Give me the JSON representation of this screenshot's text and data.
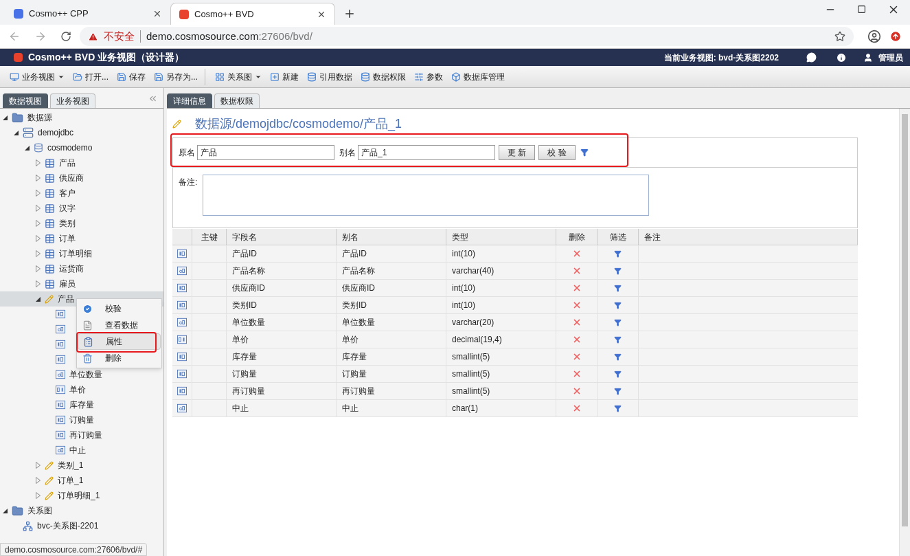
{
  "browser": {
    "tabs": [
      {
        "title": "Cosmo++ CPP",
        "selected": false
      },
      {
        "title": "Cosmo++ BVD",
        "selected": true
      }
    ],
    "security": "不安全",
    "url_host": "demo.cosmosource.com",
    "url_path": ":27606/bvd/"
  },
  "app_bar": {
    "title": "Cosmo++ BVD 业务视图（设计器）",
    "current_view": "当前业务视图: bvd-关系图2202",
    "user": "管理员"
  },
  "toolbar": {
    "groups": [
      {
        "items": [
          {
            "label": "业务视图",
            "dropdown": true
          },
          {
            "label": "打开...",
            "dropdown": false
          },
          {
            "label": "保存",
            "dropdown": false
          },
          {
            "label": "另存为...",
            "dropdown": false
          }
        ]
      },
      {
        "items": [
          {
            "label": "关系图",
            "dropdown": true
          },
          {
            "label": "新建",
            "dropdown": false
          },
          {
            "label": "引用数据",
            "dropdown": false
          },
          {
            "label": "数据权限",
            "dropdown": false
          },
          {
            "label": "参数",
            "dropdown": false
          },
          {
            "label": "数据库管理",
            "dropdown": false
          }
        ]
      }
    ]
  },
  "sidebar": {
    "tabs": [
      {
        "label": "数据视图",
        "selected": true
      },
      {
        "label": "业务视图",
        "selected": false
      }
    ],
    "tree": [
      {
        "label": "数据源",
        "kind": "folder",
        "expanded": true,
        "selected": false,
        "children": [
          {
            "label": "demojdbc",
            "kind": "server",
            "expanded": true,
            "selected": false,
            "children": [
              {
                "label": "cosmodemo",
                "kind": "database",
                "expanded": true,
                "selected": false,
                "children": [
                  {
                    "label": "产品",
                    "kind": "table",
                    "expanded": false,
                    "selected": false
                  },
                  {
                    "label": "供应商",
                    "kind": "table",
                    "expanded": false,
                    "selected": false
                  },
                  {
                    "label": "客户",
                    "kind": "table",
                    "expanded": false,
                    "selected": false
                  },
                  {
                    "label": "汉字",
                    "kind": "table",
                    "expanded": false,
                    "selected": false
                  },
                  {
                    "label": "类别",
                    "kind": "table",
                    "expanded": false,
                    "selected": false
                  },
                  {
                    "label": "订单",
                    "kind": "table",
                    "expanded": false,
                    "selected": false
                  },
                  {
                    "label": "订单明细",
                    "kind": "table",
                    "expanded": false,
                    "selected": false
                  },
                  {
                    "label": "运货商",
                    "kind": "table",
                    "expanded": false,
                    "selected": false
                  },
                  {
                    "label": "雇员",
                    "kind": "table",
                    "expanded": false,
                    "selected": false
                  },
                  {
                    "label": "产品",
                    "kind": "view",
                    "expanded": true,
                    "selected": true,
                    "children": [
                      {
                        "kind": "int",
                        "selected": false
                      },
                      {
                        "kind": "text",
                        "selected": false
                      },
                      {
                        "kind": "int",
                        "selected": false
                      },
                      {
                        "kind": "int",
                        "selected": false
                      },
                      {
                        "label": "单位数量",
                        "kind": "text",
                        "selected": false
                      },
                      {
                        "label": "单价",
                        "kind": "decimal",
                        "selected": false
                      },
                      {
                        "label": "库存量",
                        "kind": "int",
                        "selected": false
                      },
                      {
                        "label": "订购量",
                        "kind": "int",
                        "selected": false
                      },
                      {
                        "label": "再订购量",
                        "kind": "int",
                        "selected": false
                      },
                      {
                        "label": "中止",
                        "kind": "text",
                        "selected": false
                      }
                    ]
                  },
                  {
                    "label": "类别_1",
                    "kind": "view",
                    "expanded": false,
                    "selected": false
                  },
                  {
                    "label": "订单_1",
                    "kind": "view",
                    "expanded": false,
                    "selected": false
                  },
                  {
                    "label": "订单明细_1",
                    "kind": "view",
                    "expanded": false,
                    "selected": false
                  }
                ]
              }
            ]
          }
        ]
      },
      {
        "label": "关系图",
        "kind": "folder",
        "expanded": true,
        "selected": false,
        "children": [
          {
            "label": "bvc-关系图-2201",
            "kind": "diagram",
            "selected": false
          }
        ]
      }
    ]
  },
  "context_menu": {
    "items": [
      {
        "label": "校验",
        "kind": "check",
        "selected": false
      },
      {
        "label": "查看数据",
        "kind": "document",
        "selected": false
      },
      {
        "label": "属性",
        "kind": "properties",
        "selected": true
      },
      {
        "label": "删除",
        "kind": "trash",
        "selected": false
      }
    ]
  },
  "main": {
    "tabs": [
      {
        "label": "详细信息",
        "selected": true
      },
      {
        "label": "数据权限",
        "selected": false
      }
    ],
    "title": "数据源/demojdbc/cosmodemo/产品_1",
    "form": {
      "original_label": "原名",
      "original_value": "产品",
      "alias_label": "别名",
      "alias_value": "产品_1",
      "buttons": [
        "更 新",
        "校 验"
      ]
    },
    "remark_label": "备注:",
    "table": {
      "columns": [
        "主键",
        "字段名",
        "别名",
        "类型",
        "删除",
        "筛选",
        "备注"
      ],
      "rows": [
        {
          "kind": "int",
          "field": "产品ID",
          "alias": "产品ID",
          "type": "int(10)"
        },
        {
          "kind": "text",
          "field": "产品名称",
          "alias": "产品名称",
          "type": "varchar(40)"
        },
        {
          "kind": "int",
          "field": "供应商ID",
          "alias": "供应商ID",
          "type": "int(10)"
        },
        {
          "kind": "int",
          "field": "类别ID",
          "alias": "类别ID",
          "type": "int(10)"
        },
        {
          "kind": "text",
          "field": "单位数量",
          "alias": "单位数量",
          "type": "varchar(20)"
        },
        {
          "kind": "decimal",
          "field": "单价",
          "alias": "单价",
          "type": "decimal(19,4)"
        },
        {
          "kind": "int",
          "field": "库存量",
          "alias": "库存量",
          "type": "smallint(5)"
        },
        {
          "kind": "int",
          "field": "订购量",
          "alias": "订购量",
          "type": "smallint(5)"
        },
        {
          "kind": "int",
          "field": "再订购量",
          "alias": "再订购量",
          "type": "smallint(5)"
        },
        {
          "kind": "text",
          "field": "中止",
          "alias": "中止",
          "type": "char(1)"
        }
      ]
    }
  },
  "status_url": "demo.cosmosource.com:27606/bvd/#"
}
